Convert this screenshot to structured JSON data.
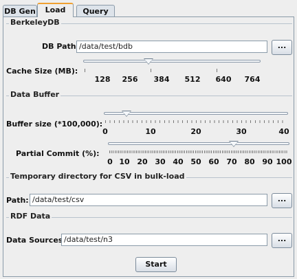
{
  "tabs": [
    {
      "label": "DB Gen"
    },
    {
      "label": "Load"
    },
    {
      "label": "Query"
    }
  ],
  "berkeley": {
    "title": "BerkeleyDB",
    "db_path_label": "DB Path:",
    "db_path_value": "/data/test/bdb",
    "browse_label": "...",
    "cache_label": "Cache Size (MB):",
    "cache_ticks": [
      "128",
      "256",
      "384",
      "512",
      "640",
      "764"
    ]
  },
  "buffer": {
    "title": "Data Buffer",
    "size_label": "Buffer size (*100,000):",
    "size_ticks": [
      "0",
      "10",
      "20",
      "30",
      "40"
    ],
    "commit_label": "Partial Commit (%):",
    "commit_ticks": [
      "0",
      "10",
      "20",
      "30",
      "40",
      "50",
      "60",
      "70",
      "80",
      "90",
      "100"
    ]
  },
  "csv": {
    "title": "Temporary directory for CSV in bulk-load",
    "path_label": "Path:",
    "path_value": "/data/test/csv",
    "browse_label": "..."
  },
  "rdf": {
    "title": "RDF Data",
    "sources_label": "Data Sources:",
    "sources_value": "/data/test/n3",
    "browse_label": "..."
  },
  "start_label": "Start"
}
